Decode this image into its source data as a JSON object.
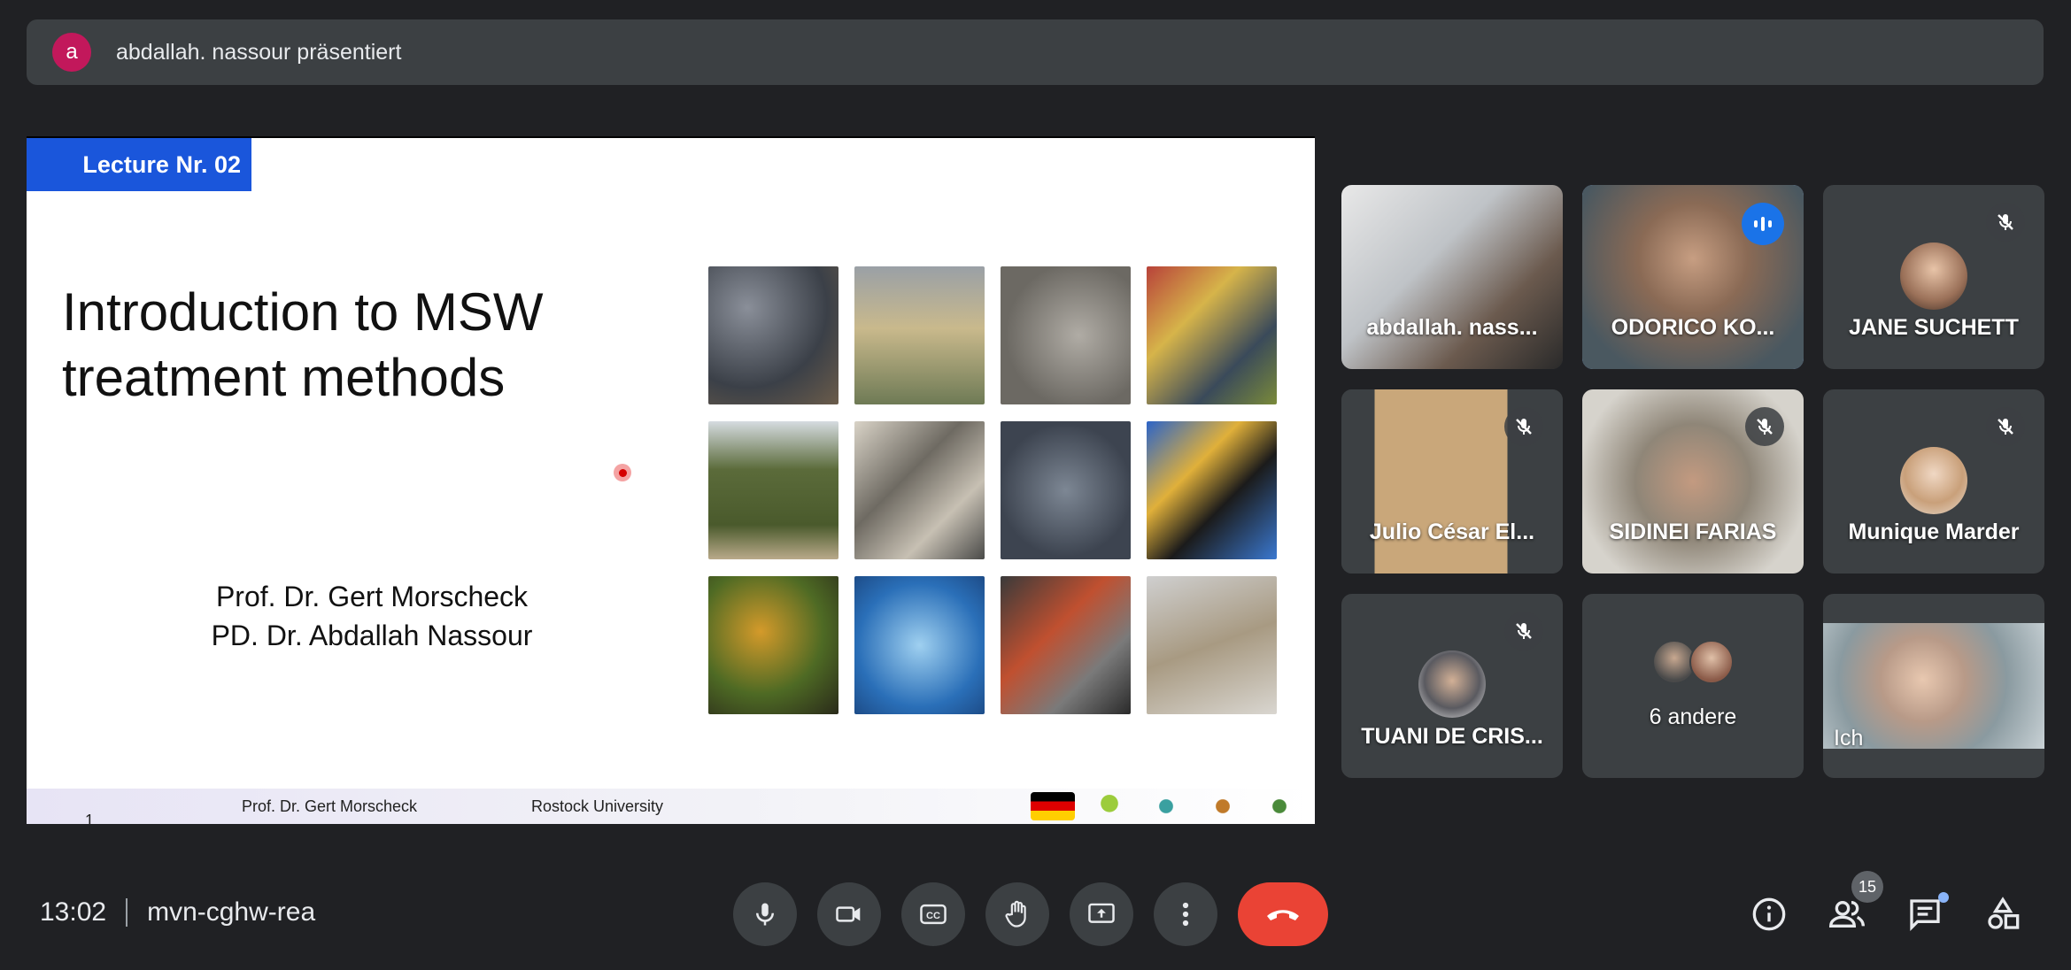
{
  "banner": {
    "avatar_letter": "a",
    "text": "abdallah. nassour präsentiert"
  },
  "slide": {
    "lecture_label": "Lecture Nr. 02",
    "title_line1": "Introduction to MSW",
    "title_line2": "treatment methods",
    "author1": "Prof. Dr. Gert Morscheck",
    "author2": "PD. Dr. Abdallah Nassour",
    "footer_author": "Prof. Dr. Gert Morscheck",
    "footer_university": "Rostock University",
    "page_number": "1"
  },
  "participants": [
    {
      "name": "abdallah. nass...",
      "muted": false,
      "speaking": false
    },
    {
      "name": "ODORICO KO...",
      "muted": false,
      "speaking": true
    },
    {
      "name": "JANE SUCHETT",
      "muted": true,
      "speaking": false
    },
    {
      "name": "Julio César El...",
      "muted": true,
      "speaking": false
    },
    {
      "name": "SIDINEI FARIAS",
      "muted": true,
      "speaking": false
    },
    {
      "name": "Munique Marder",
      "muted": true,
      "speaking": false
    },
    {
      "name": "TUANI DE CRIS...",
      "muted": true,
      "speaking": false
    },
    {
      "name": "6 andere",
      "muted": false,
      "speaking": false
    },
    {
      "name": "Ich",
      "muted": false,
      "speaking": false
    }
  ],
  "meeting": {
    "time": "13:02",
    "code": "mvn-cghw-rea"
  },
  "people_count": "15",
  "colors": {
    "background": "#202124",
    "tile": "#3c4043",
    "end_call": "#ea4335",
    "accent": "#1a73e8",
    "lecture_tag": "#1a56db"
  }
}
